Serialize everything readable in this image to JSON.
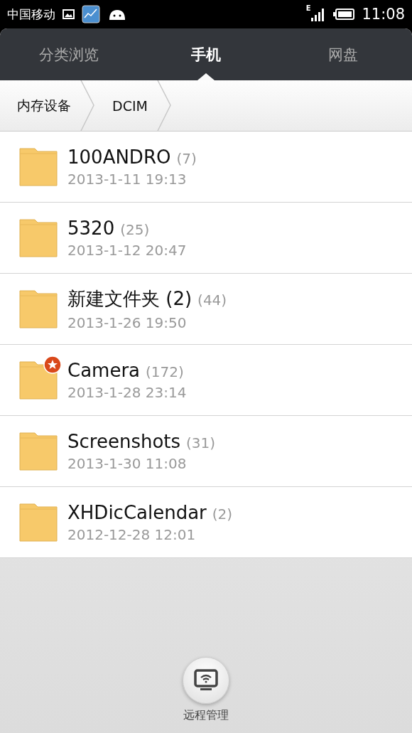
{
  "status_bar": {
    "carrier": "中国移动",
    "network": "E",
    "time": "11:08"
  },
  "tabs": [
    {
      "label": "分类浏览",
      "selected": false
    },
    {
      "label": "手机",
      "selected": true
    },
    {
      "label": "网盘",
      "selected": false
    }
  ],
  "breadcrumb": [
    "内存设备",
    "DCIM"
  ],
  "folders": [
    {
      "name": "100ANDRO",
      "count": "(7)",
      "date": "2013-1-11 19:13",
      "starred": false
    },
    {
      "name": "5320",
      "count": "(25)",
      "date": "2013-1-12 20:47",
      "starred": false
    },
    {
      "name": "新建文件夹 (2)",
      "count": "(44)",
      "date": "2013-1-26 19:50",
      "starred": false
    },
    {
      "name": "Camera",
      "count": "(172)",
      "date": "2013-1-28 23:14",
      "starred": true
    },
    {
      "name": "Screenshots",
      "count": "(31)",
      "date": "2013-1-30 11:08",
      "starred": false
    },
    {
      "name": "XHDicCalendar",
      "count": "(2)",
      "date": "2012-12-28 12:01",
      "starred": false
    }
  ],
  "remote_button": {
    "label": "远程管理"
  }
}
